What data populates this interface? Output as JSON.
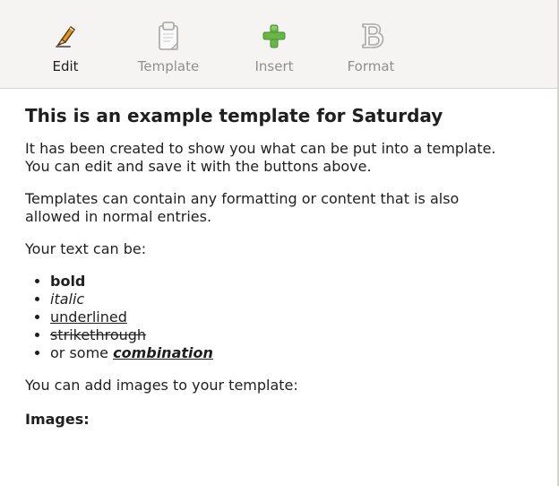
{
  "toolbar": {
    "edit": "Edit",
    "template": "Template",
    "insert": "Insert",
    "format": "Format"
  },
  "document": {
    "title": "This is an example template for Saturday",
    "p1_line1": "It has been created to show you what can be put into a template.",
    "p1_line2": "You can edit and save it with the buttons above.",
    "p2_line1": "Templates can contain any formatting or content that is also",
    "p2_line2": "allowed in normal entries.",
    "p3": "Your text can be:",
    "list": {
      "bold": "bold",
      "italic": "italic",
      "underlined": "underlined",
      "strikethrough": "strikethrough",
      "combination_prefix": "or some ",
      "combination": "combination"
    },
    "p4": "You can add images to your template:",
    "images_heading": "Images:"
  },
  "icons": {
    "edit": "pencil-icon",
    "template": "template-icon",
    "insert": "plus-icon",
    "format": "bold-b-icon"
  },
  "colors": {
    "toolbar_bg": "#f5f4f2",
    "insert_green": "#67b646",
    "disabled_text": "#8f8f8f"
  }
}
